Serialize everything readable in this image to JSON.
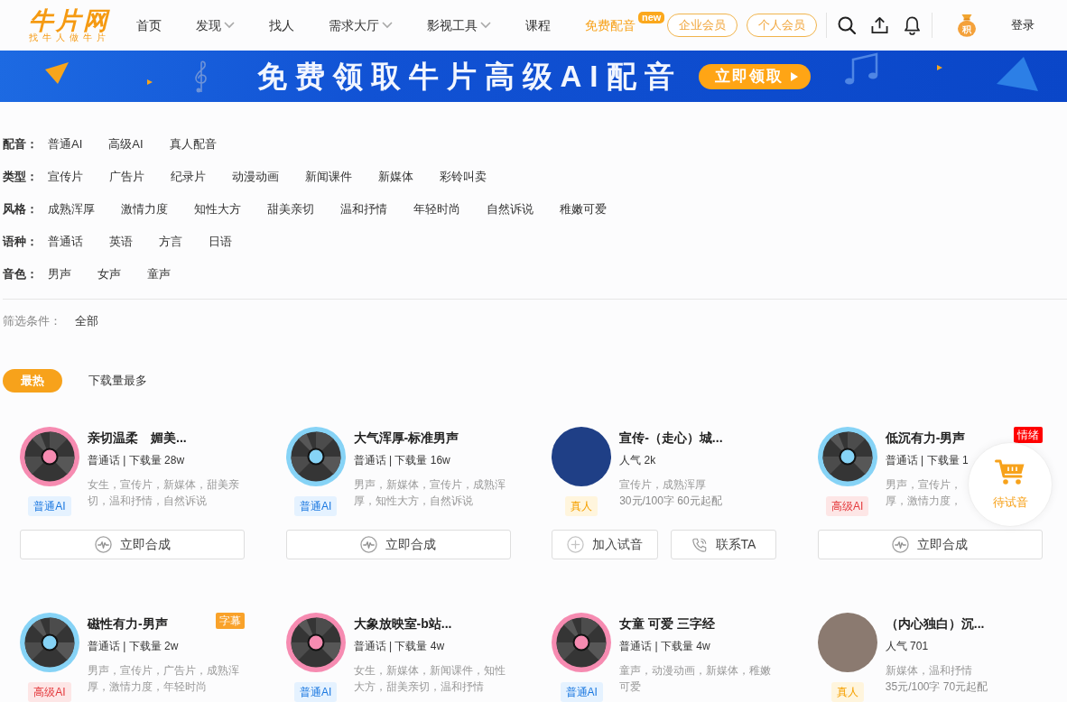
{
  "header": {
    "logo": {
      "wordmark": "牛片网",
      "slogan": "找牛人做牛片"
    },
    "nav": [
      {
        "label": "首页",
        "dropdown": false,
        "selected": false
      },
      {
        "label": "发现",
        "dropdown": true,
        "selected": false
      },
      {
        "label": "找人",
        "dropdown": false,
        "selected": false
      },
      {
        "label": "需求大厅",
        "dropdown": true,
        "selected": false
      },
      {
        "label": "影视工具",
        "dropdown": true,
        "selected": false
      },
      {
        "label": "课程",
        "dropdown": false,
        "selected": false
      },
      {
        "label": "免费配音",
        "dropdown": false,
        "selected": true,
        "badge": "new"
      }
    ],
    "membership_buttons": [
      "企业会员",
      "个人会员"
    ],
    "points_icon_label": "积",
    "login": "登录"
  },
  "banner": {
    "headline": "免费领取牛片高级AI配音",
    "button": "立即领取"
  },
  "filters": [
    {
      "label": "配音：",
      "options": [
        "普通AI",
        "高级AI",
        "真人配音"
      ]
    },
    {
      "label": "类型：",
      "options": [
        "宣传片",
        "广告片",
        "纪录片",
        "动漫动画",
        "新闻课件",
        "新媒体",
        "彩铃叫卖"
      ]
    },
    {
      "label": "风格：",
      "options": [
        "成熟浑厚",
        "激情力度",
        "知性大方",
        "甜美亲切",
        "温和抒情",
        "年轻时尚",
        "自然诉说",
        "稚嫩可爱"
      ]
    },
    {
      "label": "语种：",
      "options": [
        "普通话",
        "英语",
        "方言",
        "日语"
      ]
    },
    {
      "label": "音色：",
      "options": [
        "男声",
        "女声",
        "童声"
      ]
    }
  ],
  "active_filters": {
    "label": "筛选条件：",
    "value": "全部"
  },
  "sort_tabs": [
    {
      "label": "最热",
      "selected": true
    },
    {
      "label": "下载量最多",
      "selected": false
    }
  ],
  "voices": [
    {
      "title": "亲切温柔　媚美...",
      "avatar": {
        "kind": "record",
        "color": "#f68bb1"
      },
      "meta": "普通话 | 下载量 28w",
      "description": [
        "女生，宣传片，新媒体，甜美亲",
        "切，温和抒情，自然诉说"
      ],
      "badge": {
        "kind": "basic",
        "label": "普通AI"
      },
      "actions": [
        {
          "kind": "synthesize",
          "label": "立即合成"
        }
      ]
    },
    {
      "title": "大气浑厚-标准男声",
      "avatar": {
        "kind": "record",
        "color": "#86d3f6"
      },
      "meta": "普通话 | 下载量 16w",
      "description": [
        "男声，新媒体，宣传片，成熟浑",
        "厚，知性大方，自然诉说"
      ],
      "badge": {
        "kind": "basic",
        "label": "普通AI"
      },
      "actions": [
        {
          "kind": "synthesize",
          "label": "立即合成"
        }
      ]
    },
    {
      "title": "宣传-（走心）城...",
      "avatar": {
        "kind": "photo",
        "color": "#1f3f86"
      },
      "meta": "人气 2k",
      "description": [
        "宣传片，成熟浑厚"
      ],
      "price": "30元/100字 60元起配",
      "badge": {
        "kind": "human",
        "label": "真人"
      },
      "actions": [
        {
          "kind": "add",
          "label": "加入试音"
        },
        {
          "kind": "contact",
          "label": "联系TA"
        }
      ]
    },
    {
      "title": "低沉有力-男声",
      "tag": {
        "label": "情绪",
        "color": "#ff0000"
      },
      "avatar": {
        "kind": "record",
        "color": "#86d3f6"
      },
      "meta": "普通话 | 下载量 1",
      "description": [
        "男声，宣传片，",
        "厚，激情力度，"
      ],
      "badge": {
        "kind": "premium",
        "label": "高级AI"
      },
      "actions": [
        {
          "kind": "synthesize",
          "label": "立即合成"
        }
      ]
    },
    {
      "title": "磁性有力-男声",
      "tag": {
        "label": "字幕",
        "color": "#f9a22a"
      },
      "avatar": {
        "kind": "record",
        "color": "#86d3f6"
      },
      "meta": "普通话 | 下载量 2w",
      "description": [
        "男声，宣传片，广告片，成熟浑",
        "厚，激情力度，年轻时尚"
      ],
      "badge": {
        "kind": "premium",
        "label": "高级AI"
      }
    },
    {
      "title": "大象放映室-b站...",
      "avatar": {
        "kind": "record",
        "color": "#f68bb1"
      },
      "meta": "普通话 | 下载量 4w",
      "description": [
        "女生，新媒体，新闻课件，知性",
        "大方，甜美亲切，温和抒情"
      ],
      "badge": {
        "kind": "basic",
        "label": "普通AI"
      }
    },
    {
      "title": "女童 可爱 三字经",
      "avatar": {
        "kind": "record",
        "color": "#f68bb1"
      },
      "meta": "普通话 | 下载量 4w",
      "description": [
        "童声，动漫动画，新媒体，稚嫩",
        "可爱"
      ],
      "badge": {
        "kind": "basic",
        "label": "普通AI"
      }
    },
    {
      "title": "（内心独白）沉...",
      "avatar": {
        "kind": "photo",
        "color": "#8b7a70"
      },
      "meta": "人气 701",
      "description": [
        "新媒体，温和抒情"
      ],
      "price": "35元/100字 70元起配",
      "badge": {
        "kind": "human",
        "label": "真人"
      }
    }
  ],
  "floating_cart": {
    "label": "待试音"
  }
}
